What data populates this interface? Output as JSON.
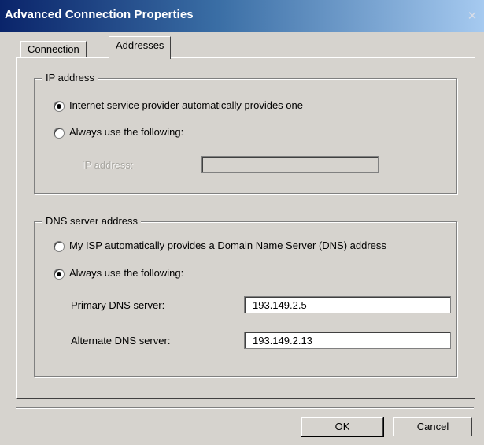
{
  "window": {
    "title": "Advanced Connection Properties",
    "close_icon": "close-icon"
  },
  "tabs": [
    {
      "label": "Connection",
      "active": false
    },
    {
      "label": "Addresses",
      "active": true
    }
  ],
  "ip_group": {
    "label": "IP address",
    "options": [
      {
        "label": "Internet service provider automatically provides one",
        "selected": true
      },
      {
        "label": "Always use the following:",
        "selected": false
      }
    ],
    "ip_field_label": "IP address:",
    "ip_field_value": ""
  },
  "dns_group": {
    "label": "DNS server address",
    "options": [
      {
        "label": "My ISP automatically provides a Domain Name Server (DNS) address",
        "selected": false
      },
      {
        "label": "Always use the following:",
        "selected": true
      }
    ],
    "primary_label": "Primary DNS server:",
    "primary_value": "193.149.2.5",
    "alternate_label": "Alternate DNS server:",
    "alternate_value": "193.149.2.13"
  },
  "buttons": {
    "ok": "OK",
    "cancel": "Cancel"
  },
  "colors": {
    "title_start": "#0a246a",
    "title_end": "#a6caf0",
    "face": "#d6d3ce"
  }
}
